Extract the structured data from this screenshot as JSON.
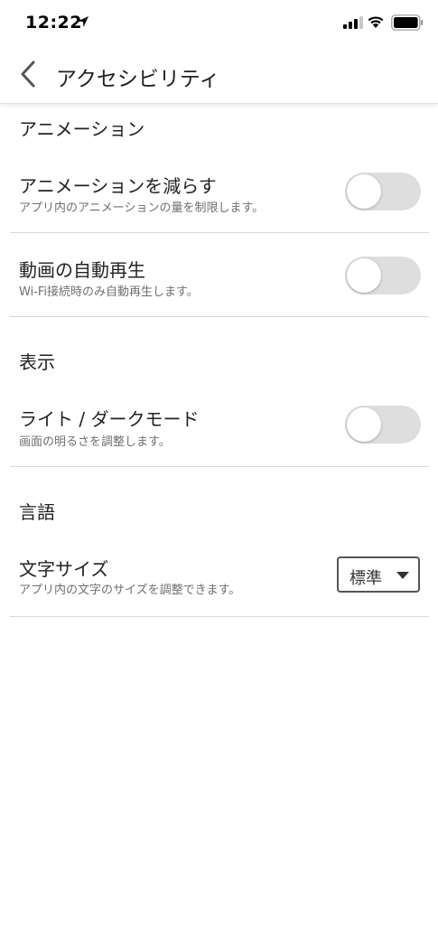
{
  "status_bar": {
    "time": "12:22",
    "icons": [
      "location-arrow-icon",
      "signal-icon",
      "wifi-icon",
      "battery-icon"
    ]
  },
  "nav": {
    "title": "アクセシビリティ",
    "back_icon": "chevron-left-icon"
  },
  "sections": {
    "animation": {
      "header": "アニメーション",
      "reduce_animation": {
        "title": "アニメーションを減らす",
        "subtitle": "アプリ内のアニメーションの量を制限します。",
        "enabled": false
      },
      "autoplay": {
        "title": "動画の自動再生",
        "subtitle": "Wi-Fi接続時のみ自動再生します。",
        "enabled": false
      }
    },
    "display": {
      "header": "表示",
      "dark_mode": {
        "title": "ライト / ダークモード",
        "subtitle": "画面の明るさを調整します。",
        "enabled": false
      }
    },
    "language": {
      "header": "言語",
      "text_size": {
        "title": "文字サイズ",
        "subtitle": "アプリ内の文字のサイズを調整できます。",
        "selected": "標準"
      }
    }
  },
  "colors": {
    "toggle_off_track": "#dedede",
    "divider": "#d9d9d9",
    "subtitle_text": "#6f6f6f"
  }
}
